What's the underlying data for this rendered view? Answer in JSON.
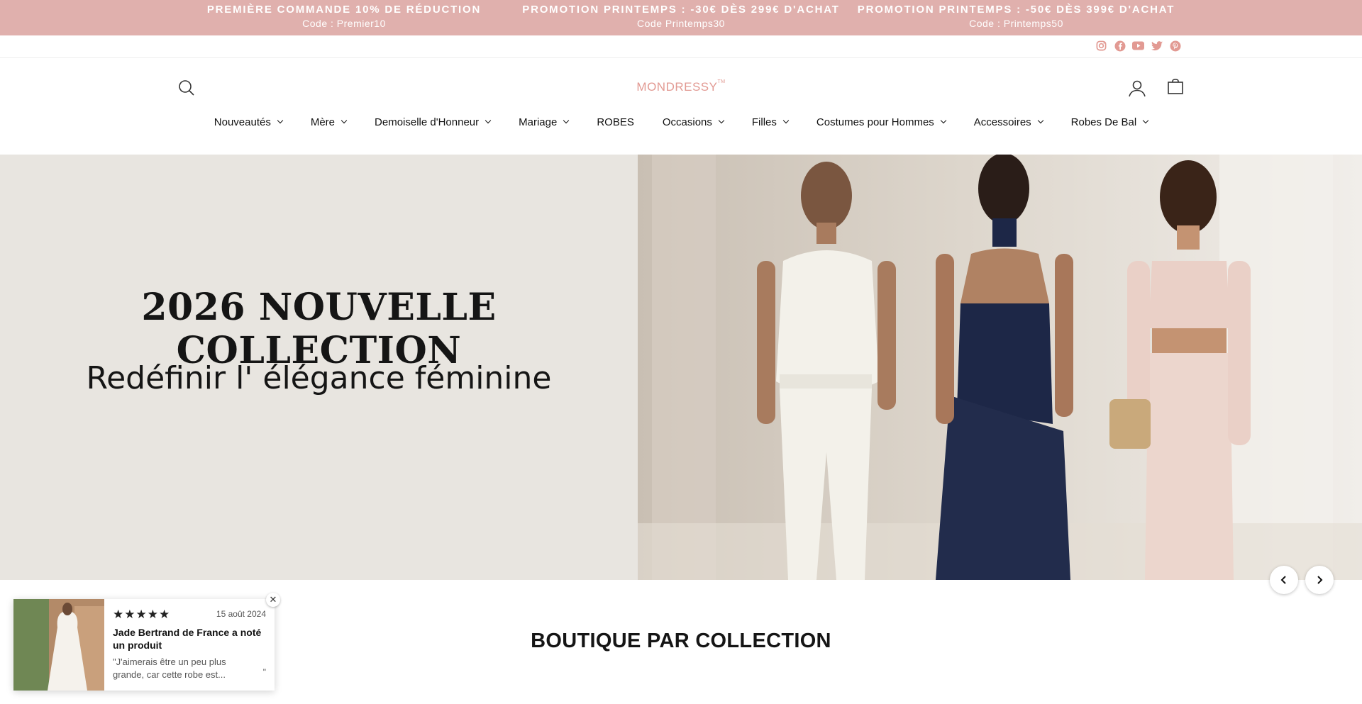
{
  "announcement": {
    "promos": [
      {
        "title": "PREMIÈRE COMMANDE 10% DE RÉDUCTION",
        "code": "Code : Premier10"
      },
      {
        "title": "PROMOTION PRINTEMPS : -30€ DÈS 299€ D'ACHAT",
        "code": "Code   Printemps30"
      },
      {
        "title": "PROMOTION PRINTEMPS : -50€ DÈS 399€ D'ACHAT",
        "code": "Code : Printemps50"
      }
    ],
    "background": "#e0b0ad"
  },
  "social": [
    "instagram-icon",
    "facebook-icon",
    "youtube-icon",
    "twitter-icon",
    "pinterest-icon"
  ],
  "header": {
    "logo": "MONDRESSY",
    "logo_mark": "TM",
    "logo_color": "#e29a93"
  },
  "nav": [
    {
      "label": "Nouveautés",
      "dropdown": true
    },
    {
      "label": "Mère",
      "dropdown": true
    },
    {
      "label": "Demoiselle d'Honneur",
      "dropdown": true
    },
    {
      "label": "Mariage",
      "dropdown": true
    },
    {
      "label": "ROBES",
      "dropdown": false
    },
    {
      "label": "Occasions",
      "dropdown": true
    },
    {
      "label": "Filles",
      "dropdown": true
    },
    {
      "label": "Costumes pour Hommes",
      "dropdown": true
    },
    {
      "label": "Accessoires",
      "dropdown": true
    },
    {
      "label": "Robes De Bal",
      "dropdown": true
    }
  ],
  "hero": {
    "title": "2026 NOUVELLE COLLECTION",
    "subtitle": "Redéfinir l'   élégance féminine"
  },
  "section": {
    "title": "BOUTIQUE PAR COLLECTION"
  },
  "review": {
    "stars": "★★★★★",
    "date": "15 août 2024",
    "name": "Jade Bertrand de France a noté un produit",
    "text": "\"J'aimerais être un peu plus grande, car cette robe est...",
    "quote": "\""
  }
}
